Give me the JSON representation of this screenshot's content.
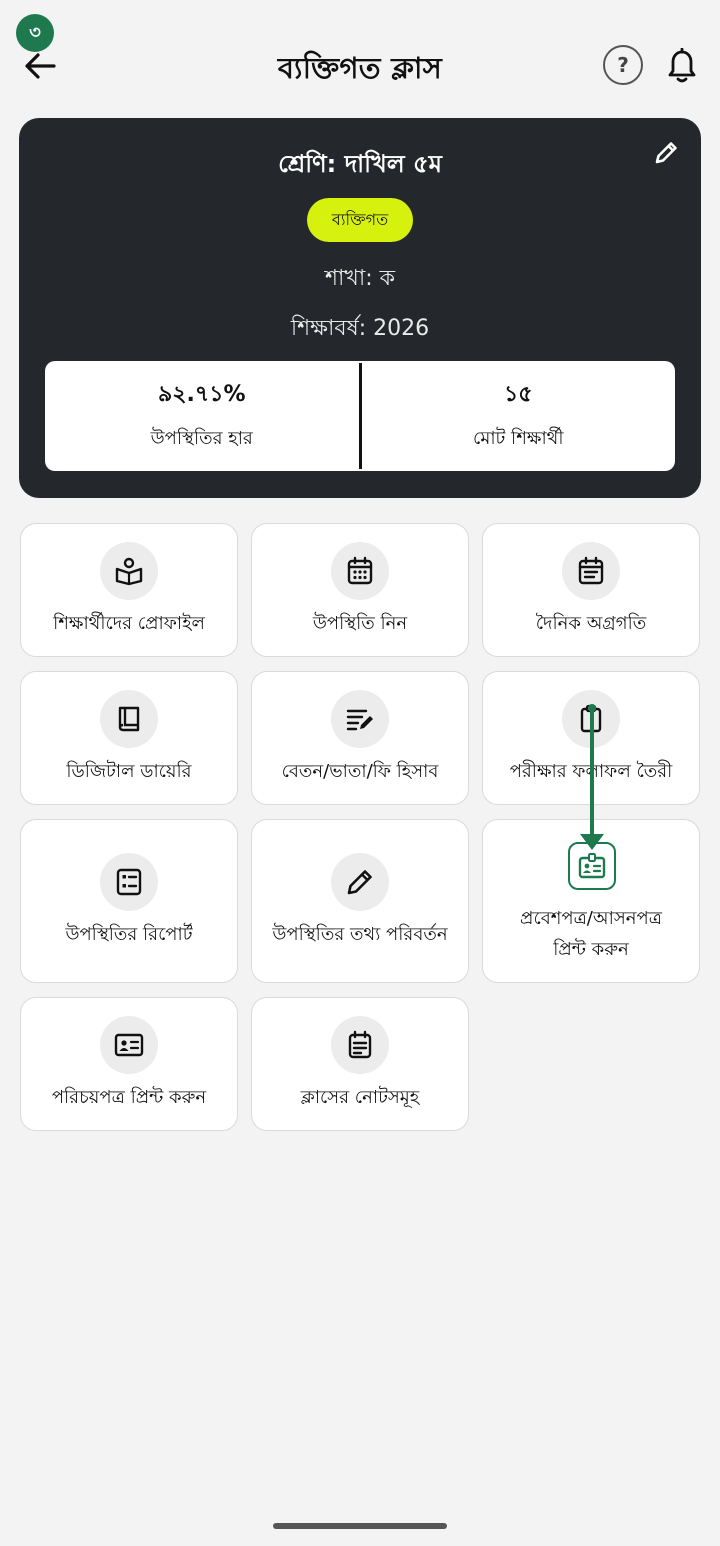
{
  "step_badge": "৩",
  "header": {
    "title": "ব্যক্তিগত ক্লাস",
    "help_label": "?"
  },
  "class_card": {
    "class_name": "শ্রেণি: দাখিল ৫ম",
    "type_badge": "ব্যক্তিগত",
    "section": "শাখা: ক",
    "session": "শিক্ষাবর্ষ: 2026",
    "stats": [
      {
        "value": "৯২.৭১%",
        "label": "উপস্থিতির হার"
      },
      {
        "value": "১৫",
        "label": "মোট শিক্ষার্থী"
      }
    ]
  },
  "tiles": [
    {
      "label": "শিক্ষার্থীদের প্রোফাইল",
      "icon": "book-reader-icon"
    },
    {
      "label": "উপস্থিতি নিন",
      "icon": "calendar-icon"
    },
    {
      "label": "দৈনিক অগ্রগতি",
      "icon": "calendar-notes-icon"
    },
    {
      "label": "ডিজিটাল ডায়েরি",
      "icon": "book-icon"
    },
    {
      "label": "বেতন/ভাতা/ফি হিসাব",
      "icon": "edit-note-icon"
    },
    {
      "label": "পরীক্ষার ফলাফল তৈরী",
      "icon": "clipboard-icon"
    },
    {
      "label": "উপস্থিতির রিপোর্ট",
      "icon": "list-report-icon"
    },
    {
      "label": "উপস্থিতির তথ্য পরিবর্তন",
      "icon": "pencil-icon"
    },
    {
      "label_line1": "প্রবেশপত্র/আসনপত্র",
      "label_line2": "প্রিন্ট করুন",
      "icon": "id-badge-icon"
    },
    {
      "label": "পরিচয়পত্র প্রিন্ট করুন",
      "icon": "id-card-icon"
    },
    {
      "label": "ক্লাসের নোটসমূহ",
      "icon": "notes-icon"
    }
  ],
  "colors": {
    "accent_green": "#1e7a4e",
    "badge_lime": "#d6f10e",
    "card_dark": "#24272b"
  }
}
